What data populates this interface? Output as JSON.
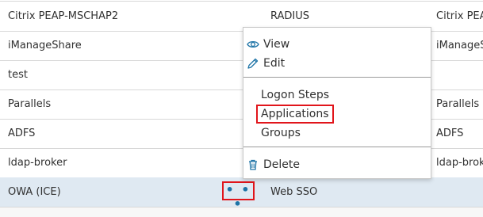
{
  "table": {
    "rows": [
      {
        "name": "Citrix PEAP-MSCHAP2",
        "type": "RADIUS",
        "name2": "Citrix PEAP-"
      },
      {
        "name": "iManageShare",
        "type": "",
        "name2": "iManageSh"
      },
      {
        "name": "test",
        "type": "",
        "name2": ""
      },
      {
        "name": "Parallels",
        "type": "",
        "name2": "Parallels"
      },
      {
        "name": "ADFS",
        "type": "",
        "name2": "ADFS"
      },
      {
        "name": "ldap-broker",
        "type": "",
        "name2": "ldap-broke"
      },
      {
        "name": "OWA (ICE)",
        "type": "Web SSO",
        "name2": ""
      }
    ]
  },
  "actions_button": {
    "label": "• • •"
  },
  "menu": {
    "view_label": "View",
    "edit_label": "Edit",
    "logon_steps_label": "Logon Steps",
    "applications_label": "Applications",
    "groups_label": "Groups",
    "delete_label": "Delete"
  },
  "icons": {
    "view": "eye-icon",
    "edit": "pencil-icon",
    "delete": "trash-icon"
  },
  "colors": {
    "accent": "#1d73a6",
    "highlight_border": "#e1151b",
    "selected_row": "#dfe9f2"
  }
}
